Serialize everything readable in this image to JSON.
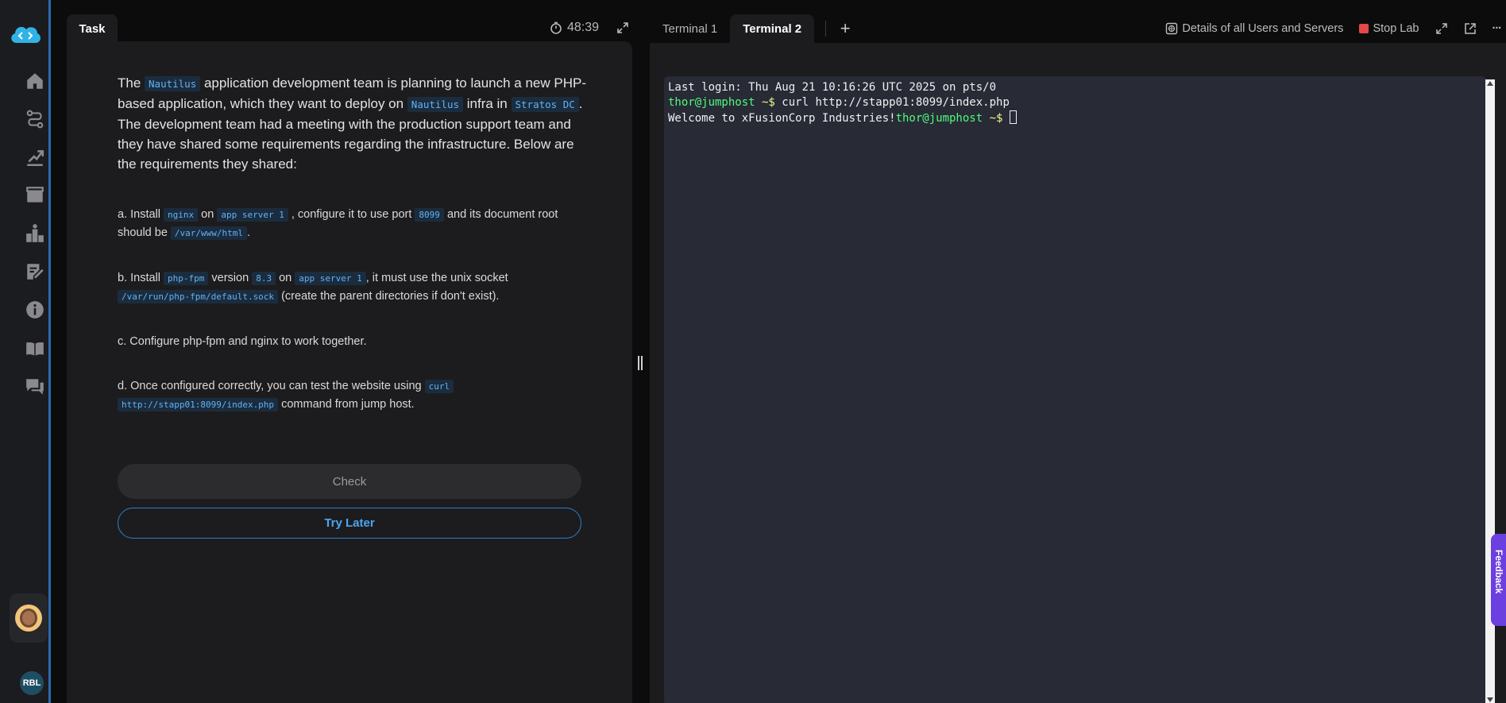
{
  "sidebar": {
    "nav_icons": [
      "home-icon",
      "roadmap-icon",
      "progress-icon",
      "tickets-icon",
      "leaderboard-icon",
      "notes-icon",
      "info-icon",
      "book-icon",
      "chat-icon"
    ],
    "user_badge": "RBL"
  },
  "task": {
    "tab_label": "Task",
    "timer": "48:39",
    "intro": {
      "t1": "The ",
      "c1": "Nautilus",
      "t2": " application development team is planning to launch a new PHP-based application, which they want to deploy on ",
      "c2": "Nautilus",
      "t3": " infra in ",
      "c3": "Stratos DC",
      "t4": ". The development team had a meeting with the production support team and they have shared some requirements regarding the infrastructure. Below are the requirements they shared:"
    },
    "req_a": {
      "t1": "a. Install ",
      "c1": "nginx",
      "t2": " on ",
      "c2": "app server 1",
      "t3": " , configure it to use port ",
      "c3": "8099",
      "t4": " and its document root should be ",
      "c4": "/var/www/html",
      "t5": "."
    },
    "req_b": {
      "t1": "b. Install ",
      "c1": "php-fpm",
      "t2": " version ",
      "c2": "8.3",
      "t3": " on ",
      "c3": "app server 1",
      "t4": ", it must use the unix socket ",
      "c4": "/var/run/php-fpm/default.sock",
      "t5": " (create the parent directories if don't exist)."
    },
    "req_c": "c. Configure php-fpm and nginx to work together.",
    "req_d": {
      "t1": "d. Once configured correctly, you can test the website using ",
      "c1": "curl",
      "c2": "http://stapp01:8099/index.php",
      "t2": " command from jump host."
    },
    "check_label": "Check",
    "try_later_label": "Try Later"
  },
  "terminal": {
    "tabs": [
      "Terminal 1",
      "Terminal 2"
    ],
    "active_tab": "Terminal 2",
    "add_tab": "+",
    "details_label": "Details of all Users and Servers",
    "stop_label": "Stop Lab",
    "more_label": "···",
    "lines": {
      "login": "Last login: Thu Aug 21 10:16:26 UTC 2025 on pts/0",
      "prompt": "thor@jumphost",
      "prompt_suffix": " ~$",
      "command": " curl http://stapp01:8099/index.php",
      "output": "Welcome to xFusionCorp Industries!"
    }
  },
  "feedback_label": "Feedback"
}
